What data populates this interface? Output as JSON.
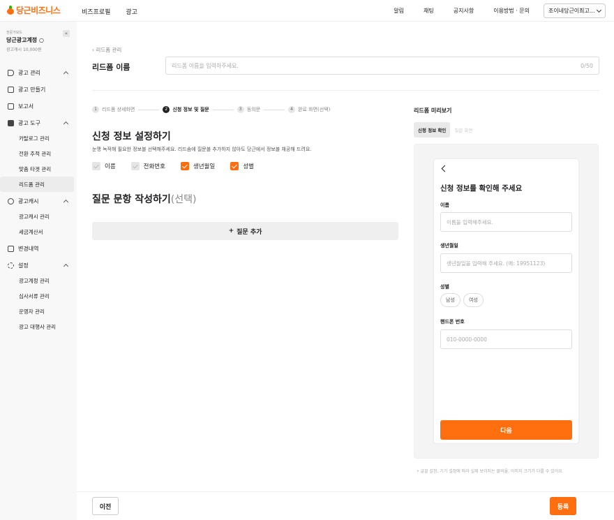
{
  "header": {
    "logo_text": "당근비즈니스",
    "nav": [
      "비즈프로필",
      "광고"
    ],
    "right_links": [
      "알림",
      "채팅",
      "공지사항",
      "이용방법 · 문의"
    ],
    "account_label": "조이네당근이최고..."
  },
  "sidebar": {
    "account_type": "전문가모드",
    "account_name": "당근광고계정 ○",
    "cash": "광고캐시 10,000원",
    "collapse_icon": "«",
    "items": {
      "ad_manage": "광고 관리",
      "ad_create": "광고 만들기",
      "report": "보고서",
      "ad_tools": "광고 도구",
      "catalog": "카탈로그 관리",
      "conversion": "전환 추적 관리",
      "custom_target": "맞춤 타겟 관리",
      "leadform": "리드폼 관리",
      "ad_cash": "광고캐시",
      "cash_manage": "광고캐시 관리",
      "tax_invoice": "세금계산서",
      "history": "변경내역",
      "settings": "설정",
      "account_manage": "광고계정 관리",
      "review_docs": "심사서류 관리",
      "operator": "운영자 관리",
      "agency": "광고 대행사 관리"
    }
  },
  "main": {
    "breadcrumb": "리드폼 관리",
    "form_name_label": "리드폼 이름",
    "form_name_placeholder": "리드폼 이름을 입력하주세요.",
    "form_name_count": "0/50",
    "steps": [
      {
        "num": "1",
        "label": "리드폼 상세화면"
      },
      {
        "num": "2",
        "label": "신청 정보 및 질문"
      },
      {
        "num": "3",
        "label": "동의문"
      },
      {
        "num": "4",
        "label": "완료 화면(선택)"
      }
    ],
    "section1_title": "신청 정보 설정하기",
    "section1_desc": "눈맹 녹적해 필요한 정보블 선택해주세요. 리드솜에 질문블 추가하지 않아도 당근에서 정보블 채공해 드려요.",
    "checks": [
      {
        "label": "이름",
        "checked": false
      },
      {
        "label": "전화번호",
        "checked": false
      },
      {
        "label": "생년월일",
        "checked": true
      },
      {
        "label": "성별",
        "checked": true
      }
    ],
    "section2_title": "질문 문항 작성하기",
    "section2_optional": "(선택)",
    "add_question": "질문 추가",
    "prev": "이전",
    "submit": "등록"
  },
  "preview": {
    "title": "리드폼 미리보기",
    "tabs": [
      "신청 정보 확인",
      "질문 화면"
    ],
    "heading": "신청 정보를 확인해 주세요",
    "name_label": "이름",
    "name_placeholder": "이름을 입력해주세요.",
    "birth_label": "생년월일",
    "birth_placeholder": "생년월일을 입력해 주세요. (예: 19951123)",
    "gender_label": "성별",
    "gender_options": [
      "남성",
      "여성"
    ],
    "phone_label": "핸드폰 번호",
    "phone_placeholder": "010-0000-0000",
    "next": "다음",
    "note": "• 글꼴 설정, 기기 설정에 따라 실제 보이지는 물비율, 이미지 크기가 다를 수 있어요."
  },
  "colors": {
    "accent": "#ff6f0f"
  }
}
